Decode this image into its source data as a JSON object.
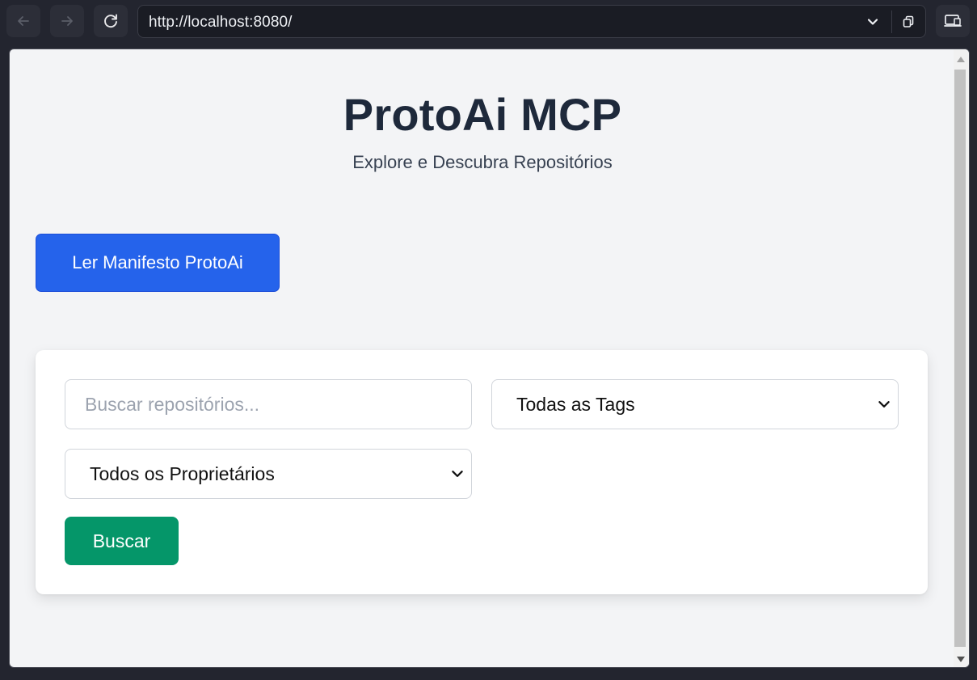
{
  "browser": {
    "url": "http://localhost:8080/",
    "icons": {
      "back": "arrow-left-icon",
      "forward": "arrow-right-icon",
      "reload": "reload-icon",
      "dropdown": "chevron-down-icon",
      "copy": "copy-icon",
      "extension": "device-icon"
    }
  },
  "page": {
    "title": "ProtoAi MCP",
    "subtitle": "Explore e Descubra Repositórios",
    "manifest_button": "Ler Manifesto ProtoAi"
  },
  "search": {
    "placeholder": "Buscar repositórios...",
    "value": "",
    "tags_select": "Todas as Tags",
    "owners_select": "Todos os Proprietários",
    "submit_label": "Buscar"
  },
  "colors": {
    "primary": "#2563eb",
    "success": "#059669",
    "background": "#f3f4f6",
    "title": "#1e293b"
  }
}
